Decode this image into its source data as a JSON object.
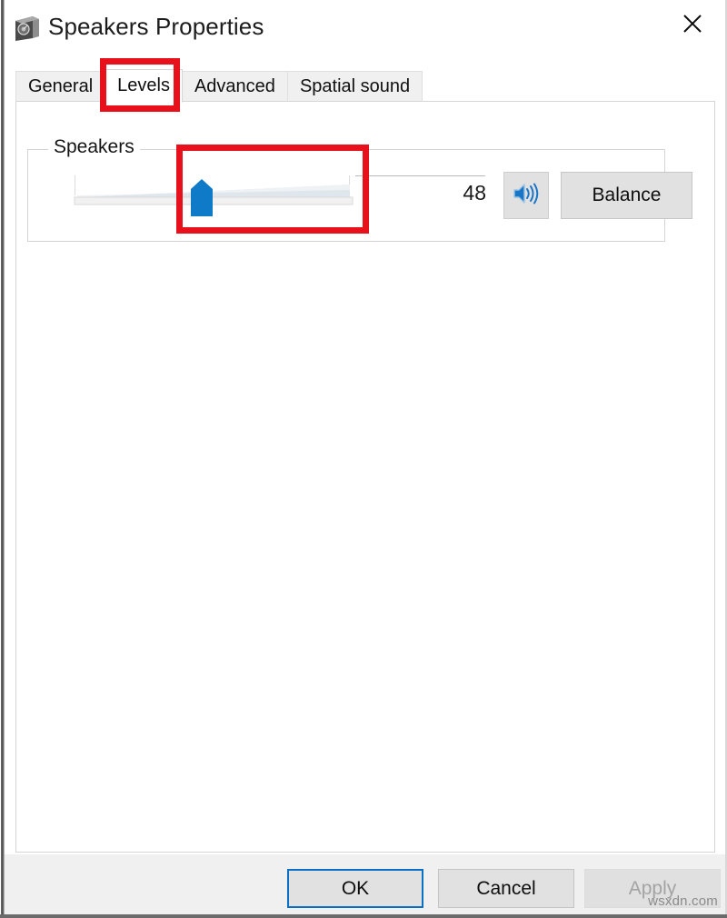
{
  "window": {
    "title": "Speakers Properties",
    "icon": "speaker-box-icon",
    "close_label": "✕"
  },
  "tabs": [
    {
      "label": "General",
      "active": false
    },
    {
      "label": "Levels",
      "active": true
    },
    {
      "label": "Advanced",
      "active": false
    },
    {
      "label": "Spatial sound",
      "active": false
    }
  ],
  "levels_panel": {
    "group_label": "Speakers",
    "volume_value": "48",
    "volume_min": 0,
    "volume_max": 100,
    "mute_button_icon": "speaker-volume-icon",
    "balance_label": "Balance"
  },
  "footer": {
    "ok_label": "OK",
    "cancel_label": "Cancel",
    "apply_label": "Apply",
    "apply_disabled": true
  },
  "watermark": "wsxdn.com",
  "colors": {
    "accent_blue": "#0f7ac7",
    "focus_blue": "#0a70c4",
    "annotation_red": "#e8101b",
    "button_face": "#e1e1e1",
    "panel_bg": "#ffffff",
    "footer_bg": "#f0f0f0",
    "disabled_text": "#a3a3a3"
  }
}
